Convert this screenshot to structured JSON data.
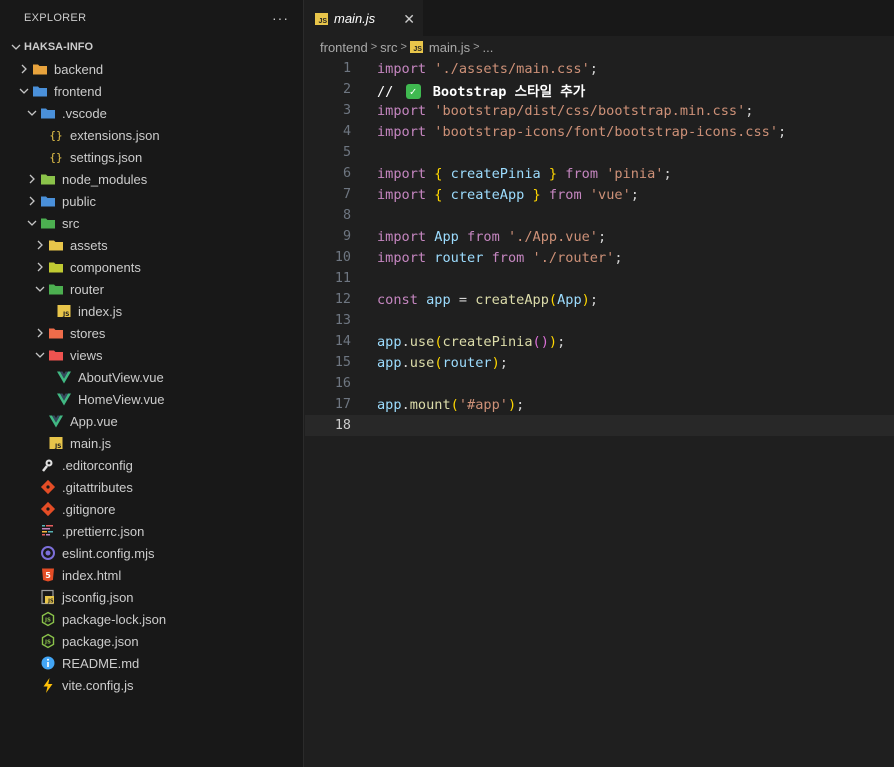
{
  "sidebar": {
    "title": "EXPLORER",
    "more": "···",
    "root": "HAKSA-INFO",
    "tree": [
      {
        "label": "backend",
        "depth": 1,
        "type": "folder",
        "expand": "closed",
        "icon": "folder-backend-icon",
        "color": "#e8a33d"
      },
      {
        "label": "frontend",
        "depth": 1,
        "type": "folder",
        "expand": "open",
        "icon": "folder-frontend-icon",
        "color": "#4a90d9"
      },
      {
        "label": ".vscode",
        "depth": 2,
        "type": "folder",
        "expand": "open",
        "icon": "folder-vscode-icon",
        "color": "#4a90d9"
      },
      {
        "label": "extensions.json",
        "depth": 3,
        "type": "file",
        "icon": "json-icon",
        "color": "#e8c54a"
      },
      {
        "label": "settings.json",
        "depth": 3,
        "type": "file",
        "icon": "json-icon",
        "color": "#e8c54a"
      },
      {
        "label": "node_modules",
        "depth": 2,
        "type": "folder",
        "expand": "closed",
        "icon": "folder-node-icon",
        "color": "#8bc34a"
      },
      {
        "label": "public",
        "depth": 2,
        "type": "folder",
        "expand": "closed",
        "icon": "folder-public-icon",
        "color": "#4a90d9"
      },
      {
        "label": "src",
        "depth": 2,
        "type": "folder",
        "expand": "open",
        "icon": "folder-src-icon",
        "color": "#4caf50"
      },
      {
        "label": "assets",
        "depth": 3,
        "type": "folder",
        "expand": "closed",
        "icon": "folder-assets-icon",
        "color": "#e8c54a"
      },
      {
        "label": "components",
        "depth": 3,
        "type": "folder",
        "expand": "closed",
        "icon": "folder-components-icon",
        "color": "#c0ca33"
      },
      {
        "label": "router",
        "depth": 3,
        "type": "folder",
        "expand": "open",
        "icon": "folder-router-icon",
        "color": "#4caf50"
      },
      {
        "label": "index.js",
        "depth": 4,
        "type": "file",
        "icon": "javascript-icon",
        "color": "#e8c54a"
      },
      {
        "label": "stores",
        "depth": 3,
        "type": "folder",
        "expand": "closed",
        "icon": "folder-stores-icon",
        "color": "#ef6c4a"
      },
      {
        "label": "views",
        "depth": 3,
        "type": "folder",
        "expand": "open",
        "icon": "folder-views-icon",
        "color": "#ef5350"
      },
      {
        "label": "AboutView.vue",
        "depth": 4,
        "type": "file",
        "icon": "vue-icon",
        "color": "#41b883"
      },
      {
        "label": "HomeView.vue",
        "depth": 4,
        "type": "file",
        "icon": "vue-icon",
        "color": "#41b883"
      },
      {
        "label": "App.vue",
        "depth": 3,
        "type": "file",
        "icon": "vue-icon",
        "color": "#41b883"
      },
      {
        "label": "main.js",
        "depth": 3,
        "type": "file",
        "icon": "javascript-icon",
        "color": "#e8c54a"
      },
      {
        "label": ".editorconfig",
        "depth": 2,
        "type": "file",
        "icon": "editorconfig-icon",
        "color": "#e0e0e0"
      },
      {
        "label": ".gitattributes",
        "depth": 2,
        "type": "file",
        "icon": "git-icon",
        "color": "#e44d26"
      },
      {
        "label": ".gitignore",
        "depth": 2,
        "type": "file",
        "icon": "git-icon",
        "color": "#e44d26"
      },
      {
        "label": ".prettierrc.json",
        "depth": 2,
        "type": "file",
        "icon": "prettier-icon",
        "color": "#c596c7"
      },
      {
        "label": "eslint.config.mjs",
        "depth": 2,
        "type": "file",
        "icon": "eslint-icon",
        "color": "#7c6fd9"
      },
      {
        "label": "index.html",
        "depth": 2,
        "type": "file",
        "icon": "html-icon",
        "color": "#e44d26"
      },
      {
        "label": "jsconfig.json",
        "depth": 2,
        "type": "file",
        "icon": "jsconfig-icon",
        "color": "#e8c54a"
      },
      {
        "label": "package-lock.json",
        "depth": 2,
        "type": "file",
        "icon": "nodejs-icon",
        "color": "#8bc34a"
      },
      {
        "label": "package.json",
        "depth": 2,
        "type": "file",
        "icon": "nodejs-icon",
        "color": "#8bc34a"
      },
      {
        "label": "README.md",
        "depth": 2,
        "type": "file",
        "icon": "info-icon",
        "color": "#42a5f5"
      },
      {
        "label": "vite.config.js",
        "depth": 2,
        "type": "file",
        "icon": "vite-icon",
        "color": "#ffc107"
      }
    ]
  },
  "editor": {
    "tab": {
      "title": "main.js",
      "icon": "javascript-icon",
      "close": "✕"
    },
    "breadcrumb": [
      "frontend",
      "src",
      "main.js",
      "..."
    ],
    "active_line": 18,
    "lines": [
      [
        [
          "kw",
          "import "
        ],
        [
          "str",
          "'./assets/main.css'"
        ],
        [
          "punc",
          ";"
        ]
      ],
      [
        [
          "cmt-mark",
          "// "
        ],
        [
          "check",
          "✓"
        ],
        [
          "cmt-rich",
          " Bootstrap 스타일 추가"
        ]
      ],
      [
        [
          "kw",
          "import "
        ],
        [
          "str",
          "'bootstrap/dist/css/bootstrap.min.css'"
        ],
        [
          "punc",
          ";"
        ]
      ],
      [
        [
          "kw",
          "import "
        ],
        [
          "str",
          "'bootstrap-icons/font/bootstrap-icons.css'"
        ],
        [
          "punc",
          ";"
        ]
      ],
      [],
      [
        [
          "kw",
          "import "
        ],
        [
          "br1",
          "{ "
        ],
        [
          "var",
          "createPinia"
        ],
        [
          "br1",
          " }"
        ],
        [
          "kw",
          " from "
        ],
        [
          "str",
          "'pinia'"
        ],
        [
          "punc",
          ";"
        ]
      ],
      [
        [
          "kw",
          "import "
        ],
        [
          "br1",
          "{ "
        ],
        [
          "var",
          "createApp"
        ],
        [
          "br1",
          " }"
        ],
        [
          "kw",
          " from "
        ],
        [
          "str",
          "'vue'"
        ],
        [
          "punc",
          ";"
        ]
      ],
      [],
      [
        [
          "kw",
          "import "
        ],
        [
          "var",
          "App"
        ],
        [
          "kw",
          " from "
        ],
        [
          "str",
          "'./App.vue'"
        ],
        [
          "punc",
          ";"
        ]
      ],
      [
        [
          "kw",
          "import "
        ],
        [
          "var",
          "router"
        ],
        [
          "kw",
          " from "
        ],
        [
          "str",
          "'./router'"
        ],
        [
          "punc",
          ";"
        ]
      ],
      [],
      [
        [
          "kw",
          "const "
        ],
        [
          "var",
          "app"
        ],
        [
          "punc",
          " = "
        ],
        [
          "fn",
          "createApp"
        ],
        [
          "br1",
          "("
        ],
        [
          "var",
          "App"
        ],
        [
          "br1",
          ")"
        ],
        [
          "punc",
          ";"
        ]
      ],
      [],
      [
        [
          "var",
          "app"
        ],
        [
          "punc",
          "."
        ],
        [
          "fn",
          "use"
        ],
        [
          "br1",
          "("
        ],
        [
          "fn",
          "createPinia"
        ],
        [
          "br2",
          "()"
        ],
        [
          "br1",
          ")"
        ],
        [
          "punc",
          ";"
        ]
      ],
      [
        [
          "var",
          "app"
        ],
        [
          "punc",
          "."
        ],
        [
          "fn",
          "use"
        ],
        [
          "br1",
          "("
        ],
        [
          "var",
          "router"
        ],
        [
          "br1",
          ")"
        ],
        [
          "punc",
          ";"
        ]
      ],
      [],
      [
        [
          "var",
          "app"
        ],
        [
          "punc",
          "."
        ],
        [
          "fn",
          "mount"
        ],
        [
          "br1",
          "("
        ],
        [
          "str",
          "'#app'"
        ],
        [
          "br1",
          ")"
        ],
        [
          "punc",
          ";"
        ]
      ],
      []
    ]
  }
}
